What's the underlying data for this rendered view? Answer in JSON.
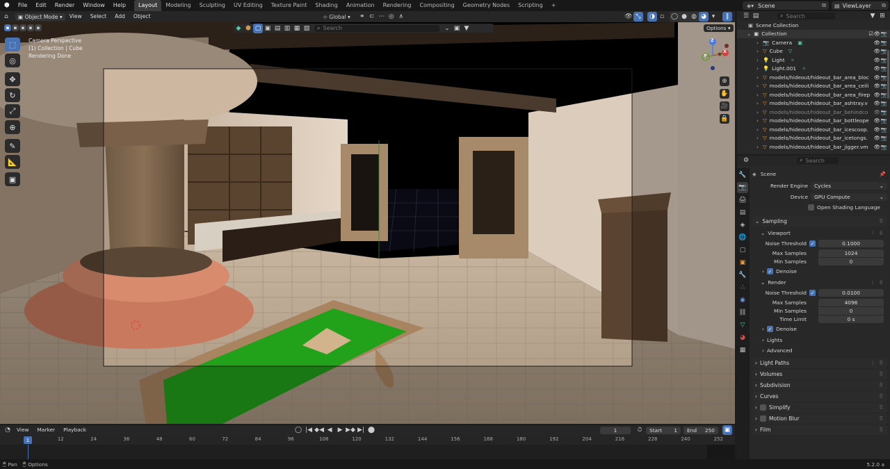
{
  "menu": [
    "File",
    "Edit",
    "Render",
    "Window",
    "Help"
  ],
  "workspace_tabs": [
    "Layout",
    "Modeling",
    "Sculpting",
    "UV Editing",
    "Texture Paint",
    "Shading",
    "Animation",
    "Rendering",
    "Compositing",
    "Geometry Nodes",
    "Scripting"
  ],
  "active_tab": "Layout",
  "scene_name": "Scene",
  "view_layer": "ViewLayer",
  "viewport_header": {
    "mode": "Object Mode",
    "menus": [
      "View",
      "Select",
      "Add",
      "Object"
    ],
    "transform": "Global",
    "search_placeholder": "Search",
    "options": "Options"
  },
  "viewport_overlay": {
    "line1": "Camera Perspective",
    "line2": "(1) Collection | Cube",
    "line3": "Rendering Done"
  },
  "gizmo": {
    "z": "Z",
    "y": "Y",
    "x": "X"
  },
  "outliner": {
    "search_placeholder": "Search",
    "root": "Scene Collection",
    "collection": "Collection",
    "items": [
      {
        "name": "Camera",
        "icon": "camera-icon"
      },
      {
        "name": "Cube",
        "icon": "mesh-icon"
      },
      {
        "name": "Light",
        "icon": "light-icon"
      },
      {
        "name": "Light.001",
        "icon": "light-icon"
      },
      {
        "name": "models/hideout/hideout_bar_area_bloc",
        "icon": "mesh-icon"
      },
      {
        "name": "models/hideout/hideout_bar_area_ceili",
        "icon": "mesh-icon"
      },
      {
        "name": "models/hideout/hideout_bar_area_firep",
        "icon": "mesh-icon"
      },
      {
        "name": "models/hideout/hideout_bar_ashtray.v",
        "icon": "mesh-icon"
      },
      {
        "name": "models/hideout/hideout_bar_behindco",
        "icon": "mesh-icon"
      },
      {
        "name": "models/hideout/hideout_bar_bottleope",
        "icon": "mesh-icon"
      },
      {
        "name": "models/hideout/hideout_bar_icescoop.",
        "icon": "mesh-icon"
      },
      {
        "name": "models/hideout/hideout_bar_icetongs.",
        "icon": "mesh-icon"
      },
      {
        "name": "models/hideout/hideout_bar_jigger.vm",
        "icon": "mesh-icon"
      }
    ]
  },
  "properties": {
    "search_placeholder": "Search",
    "context": "Scene",
    "render_engine_label": "Render Engine",
    "render_engine": "Cycles",
    "device_label": "Device",
    "device": "GPU Compute",
    "osl_label": "Open Shading Language",
    "sampling": "Sampling",
    "viewport": "Viewport",
    "vp_noise_threshold_label": "Noise Threshold",
    "vp_noise_threshold": "0.1000",
    "vp_max_samples_label": "Max Samples",
    "vp_max_samples": "1024",
    "vp_min_samples_label": "Min Samples",
    "vp_min_samples": "0",
    "vp_denoise": "Denoise",
    "render": "Render",
    "r_noise_threshold_label": "Noise Threshold",
    "r_noise_threshold": "0.0100",
    "r_max_samples_label": "Max Samples",
    "r_max_samples": "4096",
    "r_min_samples_label": "Min Samples",
    "r_min_samples": "0",
    "r_time_limit_label": "Time Limit",
    "r_time_limit": "0 s",
    "r_denoise": "Denoise",
    "lights": "Lights",
    "advanced": "Advanced",
    "panels": [
      "Light Paths",
      "Volumes",
      "Subdivision",
      "Curves",
      "Simplify",
      "Motion Blur",
      "Film"
    ]
  },
  "timeline": {
    "menus": [
      "View",
      "Marker",
      "Playback"
    ],
    "current_frame": "1",
    "start_label": "Start",
    "start": "1",
    "end_label": "End",
    "end": "250",
    "ticks": [
      "1",
      "12",
      "24",
      "36",
      "48",
      "60",
      "72",
      "84",
      "96",
      "108",
      "120",
      "132",
      "144",
      "156",
      "168",
      "180",
      "192",
      "204",
      "216",
      "228",
      "240",
      "252"
    ]
  },
  "statusbar": {
    "pan": "Pan",
    "options": "Options",
    "version": "5.2.0 a"
  },
  "colors": {
    "accent": "#4772b3",
    "header": "#262626",
    "panel": "#2b2b2b"
  }
}
